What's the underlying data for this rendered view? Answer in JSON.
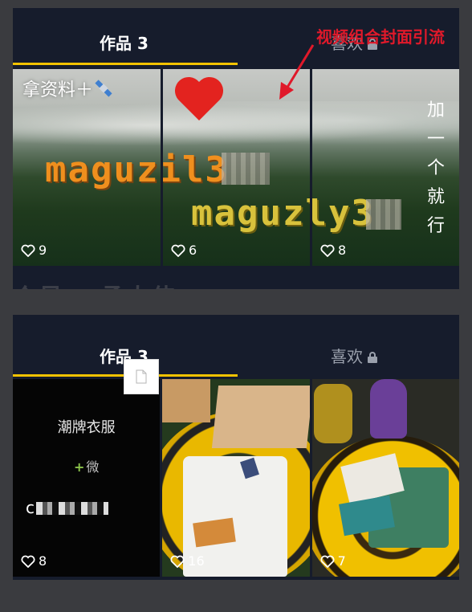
{
  "top_panel": {
    "tab_works": "作品 3",
    "tab_likes": "喜欢",
    "cells": [
      {
        "overlay_text": "拿资料＋",
        "likes": "9"
      },
      {
        "likes": "6"
      },
      {
        "vertical_text": "加一个就行",
        "likes": "8"
      }
    ],
    "pixel_text_1": "maguzil3",
    "pixel_text_2": "maguzly3",
    "annotation": "视频组合封面引流",
    "watermark": "众号： 孟大伟"
  },
  "bottom_panel": {
    "tab_works": "作品 3",
    "tab_likes": "喜欢",
    "cells": [
      {
        "line1": "潮牌衣服",
        "line2": "微",
        "line3": "c",
        "likes": "8"
      },
      {
        "likes": "16"
      },
      {
        "likes": "7"
      }
    ]
  },
  "colors": {
    "tab_underline": "#f2c200",
    "annotation": "#e0192a",
    "panel_bg": "#161c2c"
  }
}
